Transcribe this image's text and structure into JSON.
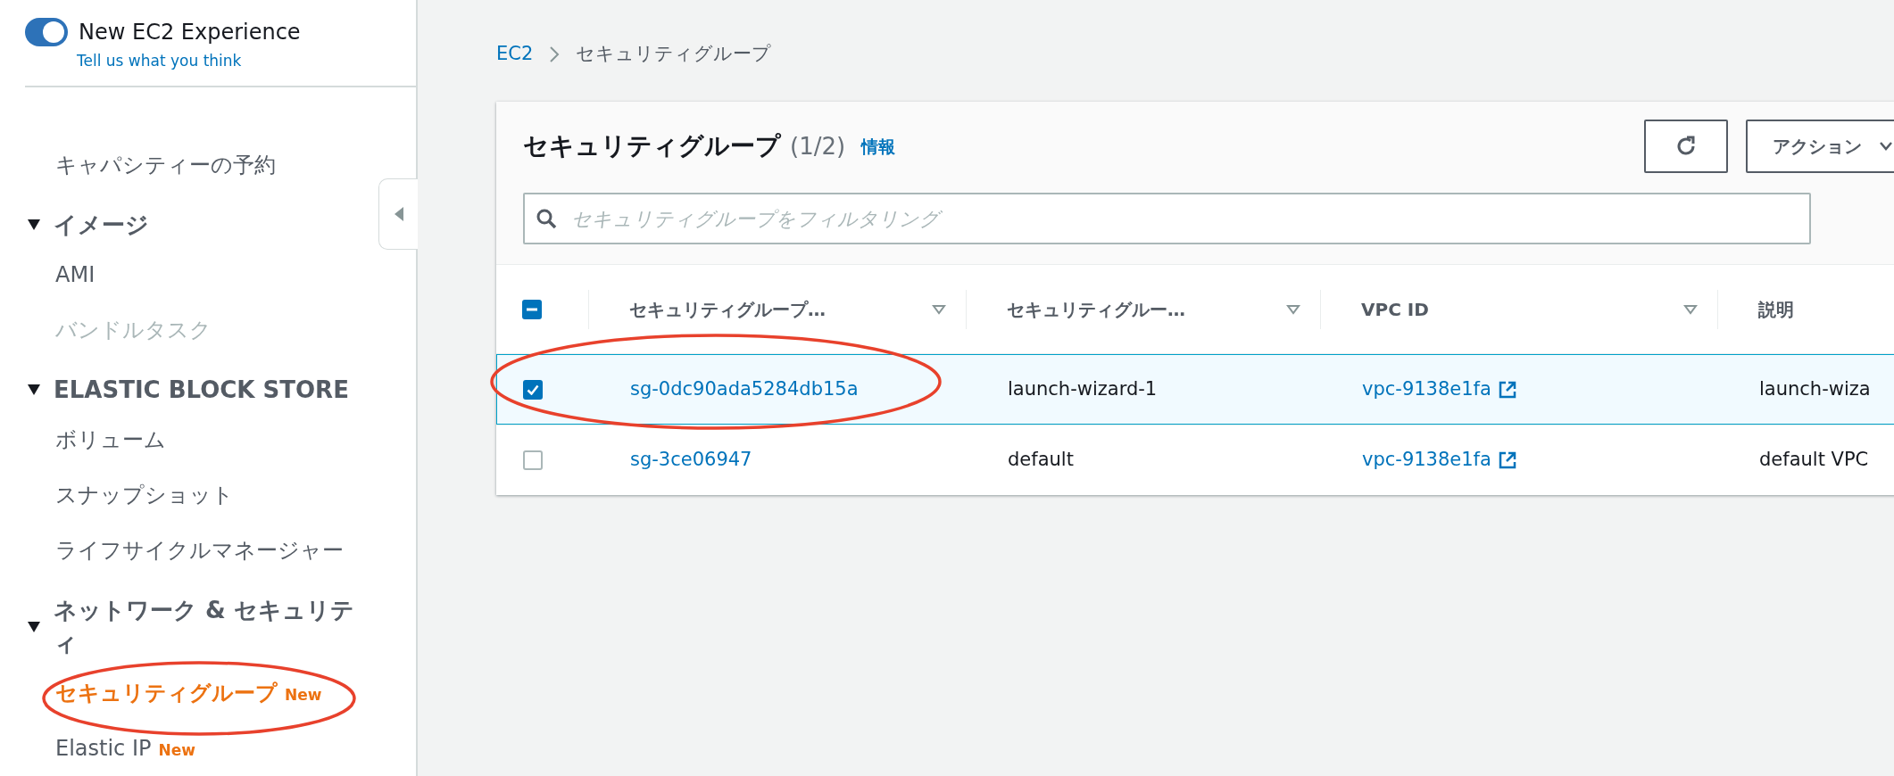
{
  "sidebar": {
    "toggle": {
      "label": "New EC2 Experience",
      "on": true
    },
    "feedback_link": "Tell us what you think",
    "items": [
      {
        "kind": "item",
        "label": "キャパシティーの予約",
        "disabled": false,
        "selected": false
      },
      {
        "kind": "section",
        "label": "イメージ",
        "expanded": true
      },
      {
        "kind": "item",
        "label": "AMI",
        "disabled": false,
        "selected": false
      },
      {
        "kind": "item",
        "label": "バンドルタスク",
        "disabled": true,
        "selected": false
      },
      {
        "kind": "section",
        "label": "ELASTIC BLOCK STORE",
        "expanded": true
      },
      {
        "kind": "item",
        "label": "ボリューム",
        "disabled": false,
        "selected": false
      },
      {
        "kind": "item",
        "label": "スナップショット",
        "disabled": false,
        "selected": false
      },
      {
        "kind": "item",
        "label": "ライフサイクルマネージャー",
        "disabled": false,
        "selected": false
      },
      {
        "kind": "section",
        "label": "ネットワーク & セキュリティ",
        "expanded": true
      },
      {
        "kind": "item",
        "label": "セキュリティグループ",
        "badge": "New",
        "disabled": false,
        "selected": true
      },
      {
        "kind": "item",
        "label": "Elastic IP",
        "badge": "New",
        "disabled": false,
        "selected": false
      }
    ]
  },
  "breadcrumb": [
    {
      "label": "EC2",
      "link": true
    },
    {
      "label": "セキュリティグループ",
      "link": false
    }
  ],
  "panel": {
    "title": "セキュリティグループ",
    "count": "(1/2)",
    "info_link": "情報",
    "actions_button": "アクション",
    "search": {
      "placeholder": "セキュリティグループをフィルタリング"
    },
    "select_all": {
      "indeterminate": true
    },
    "columns": [
      {
        "label": "セキュリティグループ…",
        "sortable": true
      },
      {
        "label": "セキュリティグルー…",
        "sortable": true
      },
      {
        "label": "VPC ID",
        "sortable": true
      },
      {
        "label": "説明",
        "sortable": false
      }
    ],
    "rows": [
      {
        "selected": true,
        "id": "sg-0dc90ada5284db15a",
        "name": "launch-wizard-1",
        "vpc_id": "vpc-9138e1fa",
        "description": "launch-wiza"
      },
      {
        "selected": false,
        "id": "sg-3ce06947",
        "name": "default",
        "vpc_id": "vpc-9138e1fa",
        "description": "default VPC"
      }
    ]
  }
}
